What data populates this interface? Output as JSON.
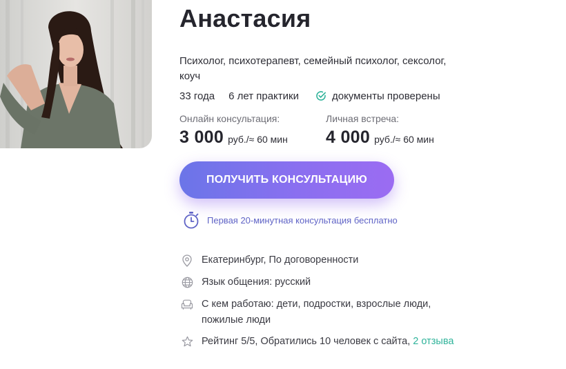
{
  "profile": {
    "name": "Анастасия",
    "specialties": "Психолог, психотерапевт, семейный психолог, сексолог, коуч",
    "age": "33 года",
    "practice": "6 лет практики",
    "verified": "документы проверены"
  },
  "prices": {
    "online": {
      "label": "Онлайн консультация:",
      "value": "3 000",
      "unit": "руб./≈ 60 мин"
    },
    "personal": {
      "label": "Личная встреча:",
      "value": "4 000",
      "unit": "руб./≈ 60 мин"
    }
  },
  "cta": {
    "label": "ПОЛУЧИТЬ КОНСУЛЬТАЦИЮ"
  },
  "free_note": "Первая 20-минутная консультация бесплатно",
  "info": {
    "location": "Екатеринбург, По договоренности",
    "language": "Язык общения: русский",
    "audience": "С кем работаю: дети, подростки, взрослые люди, пожилые люди",
    "rating_text": "Рейтинг 5/5, Обратились 10 человек с сайта,",
    "reviews_link": "2 отзыва"
  },
  "colors": {
    "accent_gradient_start": "#6b75e8",
    "accent_gradient_end": "#9b6cf2",
    "check_teal": "#2fb39a",
    "note_purple": "#5f63c6"
  },
  "icons": {
    "verified": "check-circle-icon",
    "free_note": "stopwatch-icon",
    "location": "map-pin-icon",
    "language": "globe-icon",
    "audience": "armchair-icon",
    "rating": "star-icon"
  }
}
